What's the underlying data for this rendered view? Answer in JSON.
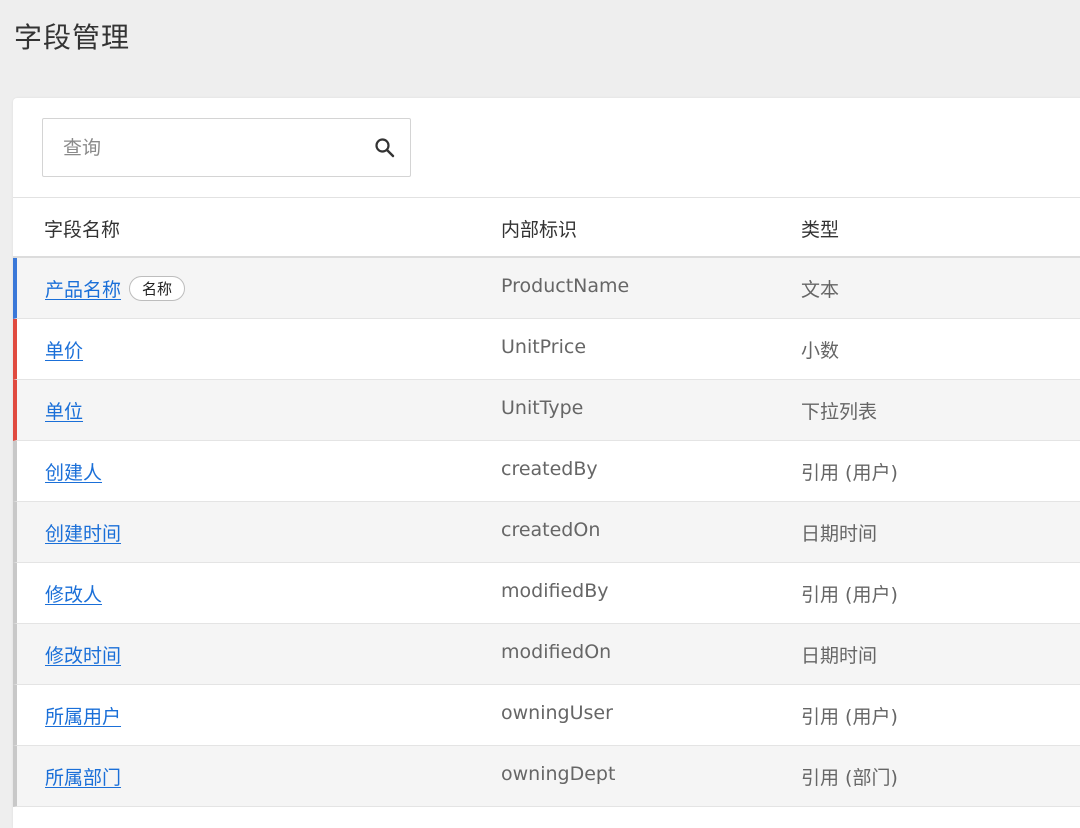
{
  "page": {
    "title": "字段管理"
  },
  "search": {
    "placeholder": "查询"
  },
  "table": {
    "headers": [
      "字段名称",
      "内部标识",
      "类型"
    ],
    "rows": [
      {
        "name": "产品名称",
        "badge": "名称",
        "id": "ProductName",
        "type": "文本",
        "marker": "#3a78d8"
      },
      {
        "name": "单价",
        "badge": "",
        "id": "UnitPrice",
        "type": "小数",
        "marker": "#e04a3f"
      },
      {
        "name": "单位",
        "badge": "",
        "id": "UnitType",
        "type": "下拉列表",
        "marker": "#e04a3f"
      },
      {
        "name": "创建人",
        "badge": "",
        "id": "createdBy",
        "type": "引用 (用户)",
        "marker": "#c8c8c8"
      },
      {
        "name": "创建时间",
        "badge": "",
        "id": "createdOn",
        "type": "日期时间",
        "marker": "#c8c8c8"
      },
      {
        "name": "修改人",
        "badge": "",
        "id": "modifiedBy",
        "type": "引用 (用户)",
        "marker": "#c8c8c8"
      },
      {
        "name": "修改时间",
        "badge": "",
        "id": "modifiedOn",
        "type": "日期时间",
        "marker": "#c8c8c8"
      },
      {
        "name": "所属用户",
        "badge": "",
        "id": "owningUser",
        "type": "引用 (用户)",
        "marker": "#c8c8c8"
      },
      {
        "name": "所属部门",
        "badge": "",
        "id": "owningDept",
        "type": "引用 (部门)",
        "marker": "#c8c8c8"
      }
    ]
  },
  "colors": {
    "link": "#1a6fd8",
    "primary_marker": "#3a78d8",
    "required_marker": "#e04a3f",
    "system_marker": "#c8c8c8"
  },
  "icons": {
    "search": "search-icon"
  }
}
